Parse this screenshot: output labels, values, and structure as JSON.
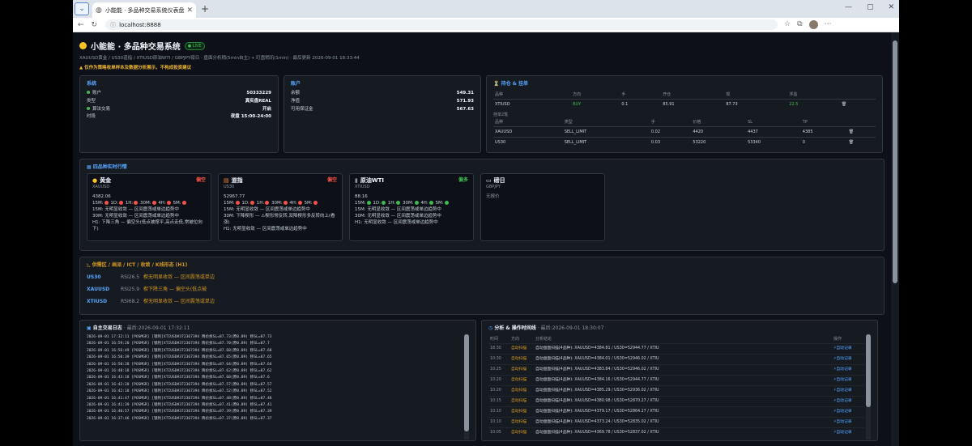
{
  "browser": {
    "tab_title": "小能能 · 多品种交易系统仪表盘",
    "url": "localhost:8888"
  },
  "header": {
    "title": "小能能 · 多品种交易系统",
    "live": "● LIVE",
    "subtitle": "XAUUSD黄金 / US30道指 / XTIUSD原油WTI / GBPJPY磅日 · 盘面分析稍(5min自主) + 盯盘稍讯(1min) · 最后更新 2026-09-01 18:33:44",
    "warning": "▲ 仅作为策略收单样本及数据分析展示，不构成投资建议"
  },
  "system": {
    "title": "系统",
    "rows": [
      {
        "k": "账户",
        "v": "50333229",
        "dot": true
      },
      {
        "k": "类型",
        "v": "真实盘REAL",
        "dot": false
      },
      {
        "k": "算法交易",
        "v": "开启",
        "dot": true
      },
      {
        "k": "时段",
        "v": "夜盘 15:00-24:00",
        "dot": false
      }
    ]
  },
  "account": {
    "title": "账户",
    "rows": [
      {
        "k": "余额",
        "v": "549.31"
      },
      {
        "k": "净值",
        "v": "571.93"
      },
      {
        "k": "可用保证金",
        "v": "567.63"
      }
    ]
  },
  "positions": {
    "title": "持仓 & 挂单",
    "headers": [
      "品种",
      "方向",
      "手",
      "开仓",
      "现",
      "浮盈",
      ""
    ],
    "rows": [
      {
        "sym": "XTIUSD",
        "dir": "BUY",
        "lots": "0.1",
        "open": "85.91",
        "cur": "87.73",
        "pnl": "22.5",
        "icon": "🗑"
      }
    ],
    "pending_title": "挂单2笔",
    "pending_headers": [
      "品种",
      "类型",
      "手",
      "价格",
      "SL",
      "TP",
      ""
    ],
    "pending": [
      {
        "sym": "XAUUSD",
        "type": "SELL_LIMIT",
        "lots": "0.02",
        "price": "4420",
        "sl": "4437",
        "tp": "4385",
        "icon": "🗑"
      },
      {
        "sym": "US30",
        "type": "SELL_LIMIT",
        "lots": "0.03",
        "price": "53220",
        "sl": "53340",
        "tp": "0",
        "icon": "🗑"
      }
    ]
  },
  "quotes": {
    "title": "四品种实时行情",
    "cards": [
      {
        "name": "黄金",
        "sym": "XAUUSD",
        "signal": "偏空",
        "sigcolor": "#f85149",
        "price": "4382.06",
        "dots": [
          "#f85149",
          "#f85149",
          "#f85149",
          "#f85149",
          "#f85149",
          "#f85149"
        ],
        "lines": [
          "15M: 无明显收敛 — 区间震荡或单边趋势中",
          "30M: 无明显收敛 — 区间震荡或单边趋势中",
          "H1: 下降三角 — 偏空头(低点被撑平,高点走低,常被位向下)"
        ]
      },
      {
        "name": "道指",
        "sym": "US30",
        "signal": "偏空",
        "sigcolor": "#f85149",
        "price": "52967.77",
        "dots": [
          "#f85149",
          "#f85149",
          "#f85149",
          "#f85149",
          "#f85149",
          "#f85149"
        ],
        "lines": [
          "15M: 无明显收敛 — 区间震荡或单边趋势中",
          "30M: 下降楔形 — ⚠楔形常反转,双降楔形多反转向上(看涨)",
          "H1: 无明显收敛 — 区间震荡或单边趋势中"
        ]
      },
      {
        "name": "原油WTI",
        "sym": "XTIUSD",
        "signal": "偏多",
        "sigcolor": "#3fb950",
        "price": "88.16",
        "dots": [
          "#3fb950",
          "#3fb950",
          "#3fb950",
          "#3fb950",
          "#3fb950",
          "#3fb950"
        ],
        "lines": [
          "15M: 无明显收敛 — 区间震荡或单边趋势中",
          "30M: 无明显收敛 — 区间震荡或单边趋势中",
          "H1: 无明显收敛 — 区间震荡或单边趋势中"
        ]
      },
      {
        "name": "磅日",
        "sym": "GBPJPY",
        "signal": "",
        "sigcolor": "#8b949e",
        "price": "无报价",
        "dots": [],
        "lines": []
      }
    ],
    "tf": [
      "15M:",
      "1D:",
      "1H:",
      "30M:",
      "4H:",
      "5M:"
    ]
  },
  "fvg": {
    "title": "供需区 / 画派 / ICT / 收敛 / K线形态 (H1)",
    "rows": [
      {
        "sym": "US30",
        "rsi": "RSI26.5",
        "text": "楔无明显收敛 — 区间震荡或单边"
      },
      {
        "sym": "XAUUSD",
        "rsi": "RSI25.9",
        "text": "楔下降三角 — 偏空头(低点被"
      },
      {
        "sym": "XTIUSD",
        "rsi": "RSI68.2",
        "text": "楔无明显收敛 — 区间震荡或单边"
      }
    ]
  },
  "log": {
    "title": "自主交易日志",
    "latest": "· 最后:2026-09-01 17:32:11",
    "lines": [
      "2026-09-01 17:32:11 [POSMGR] [锁利]XTIUSD#372367394 降价拆SL=87.73(原0.89) 移SL=87.73",
      "2026-09-01 16:59:20 [POSMGR] [锁利]XTIUSD#372367394 降价拆SL=87.70(原0.89) 移SL=87.7",
      "2026-09-01 16:56:49 [POSMGR] [锁利]XTIUSD#372367394 降价拆SL=87.68(原0.89) 移SL=87.68",
      "2026-09-01 16:50:39 [POSMGR] [锁利]XTIUSD#372367394 降价拆SL=87.65(原0.89) 移SL=87.65",
      "2026-09-01 16:50:28 [POSMGR] [锁利]XTIUSD#372367394 降价拆SL=87.64(原0.89) 移SL=87.64",
      "2026-09-01 16:48:18 [POSMGR] [锁利]XTIUSD#372367394 降价拆SL=87.62(原0.89) 移SL=87.62",
      "2026-09-01 16:43:18 [POSMGR] [锁利]XTIUSD#372367394 降价拆SL=87.60(原0.89) 移SL=87.6",
      "2026-09-01 16:42:28 [POSMGR] [锁利]XTIUSD#372367394 降价拆SL=87.57(原0.89) 移SL=87.57",
      "2026-09-01 16:42:18 [POSMGR] [锁利]XTIUSD#372367394 降价拆SL=87.52(原0.89) 移SL=87.52",
      "2026-09-01 16:41:47 [POSMGR] [锁利]XTIUSD#372367394 降价拆SL=87.48(原0.89) 移SL=87.48",
      "2026-09-01 16:41:39 [POSMGR] [锁利]XTIUSD#372367394 降价拆SL=87.41(原0.89) 移SL=87.41",
      "2026-09-01 16:40:57 [POSMGR] [锁利]XTIUSD#372367394 降价拆SL=87.39(原0.89) 移SL=87.39",
      "2026-09-01 16:37:46 [POSMGR] [锁利]XTIUSD#372367394 降价拆SL=87.37(原0.89) 移SL=87.37"
    ]
  },
  "analysis": {
    "title": "分析 & 操作时间线",
    "latest": "· 最后:2026-09-01 18:30:07",
    "headers": [
      "时间",
      "方向",
      "分析结论",
      "操作"
    ],
    "rows": [
      {
        "t": "18:30",
        "d": "自动扫描",
        "c": "自动盘面扫描(4品种): XAUUSD=4384.81 / US30=52944.77 / XTIU",
        "op": "⚡自动记录"
      },
      {
        "t": "10:30",
        "d": "自动扫描",
        "c": "自动盘面扫描(4品种): XAUUSD=4384.01 / US30=52946.02 / XTIU",
        "op": "⚡自动记录"
      },
      {
        "t": "10:25",
        "d": "自动扫描",
        "c": "自动盘面扫描(4品种): XAUUSD=4383.84 / US30=52946.02 / XTIU",
        "op": "⚡自动记录"
      },
      {
        "t": "10:20",
        "d": "自动扫描",
        "c": "自动盘面扫描(4品种): XAUUSD=4384.16 / US30=52944.77 / XTIU",
        "op": "⚡自动记录"
      },
      {
        "t": "10:20",
        "d": "自动扫描",
        "c": "自动盘面扫描(4品种): XAUUSD=4385.29 / US30=52936.02 / XTIU",
        "op": "⚡自动记录"
      },
      {
        "t": "10:15",
        "d": "自动扫描",
        "c": "自动盘面扫描(4品种): XAUUSD=4380.98 / US30=52870.27 / XTIU",
        "op": "⚡自动记录"
      },
      {
        "t": "10:10",
        "d": "自动扫描",
        "c": "自动盘面扫描(4品种): XAUUSD=4379.17 / US30=52864.27 / XTIU",
        "op": "⚡自动记录"
      },
      {
        "t": "10:10",
        "d": "自动扫描",
        "c": "自动盘面扫描(4品种): XAUUSD=4373.24 / US30=52835.02 / XTIU",
        "op": "⚡自动记录"
      },
      {
        "t": "10:05",
        "d": "自动扫描",
        "c": "自动盘面扫描(4品种): XAUUSD=4369.78 / US30=52837.02 / XTIU",
        "op": "⚡自动记录"
      }
    ]
  }
}
